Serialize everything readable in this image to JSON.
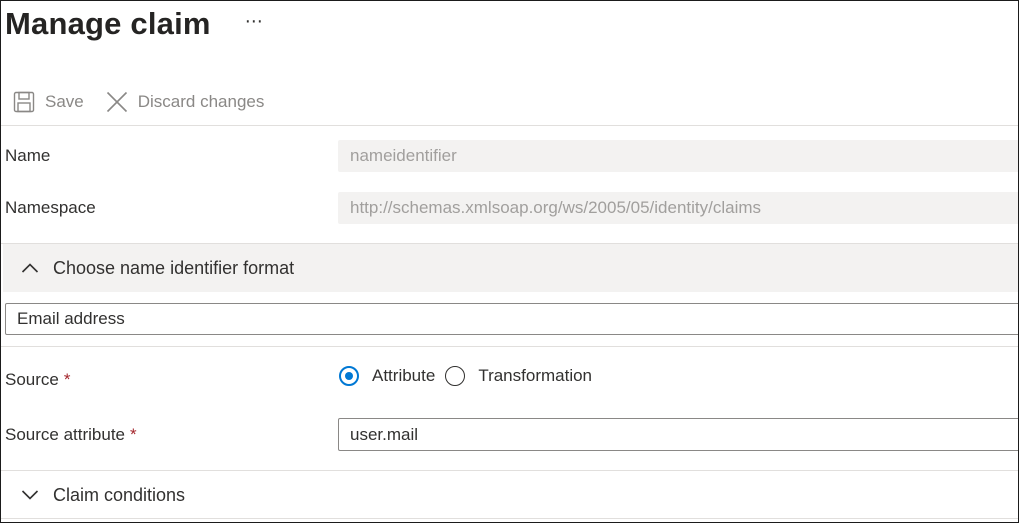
{
  "header": {
    "title": "Manage claim",
    "more_label": "⋯"
  },
  "toolbar": {
    "save_label": "Save",
    "discard_label": "Discard changes"
  },
  "fields": {
    "name": {
      "label": "Name",
      "value": "nameidentifier"
    },
    "namespace": {
      "label": "Namespace",
      "value": "http://schemas.xmlsoap.org/ws/2005/05/identity/claims"
    }
  },
  "name_id_section": {
    "label": "Choose name identifier format",
    "expanded": true,
    "selected_format": "Email address"
  },
  "source": {
    "label": "Source",
    "required_mark": "*",
    "options": [
      {
        "label": "Attribute",
        "selected": true
      },
      {
        "label": "Transformation",
        "selected": false
      }
    ]
  },
  "source_attribute": {
    "label": "Source attribute",
    "required_mark": "*",
    "value": "user.mail"
  },
  "claim_conditions": {
    "label": "Claim conditions",
    "expanded": false
  },
  "colors": {
    "accent": "#0078d4",
    "required": "#a4262c",
    "disabled_text": "#8a8886",
    "section_bg": "#f3f2f1"
  },
  "icons": {
    "save": "save-icon",
    "discard": "close-icon",
    "expand": "chevron-up-icon",
    "collapse": "chevron-down-icon"
  }
}
